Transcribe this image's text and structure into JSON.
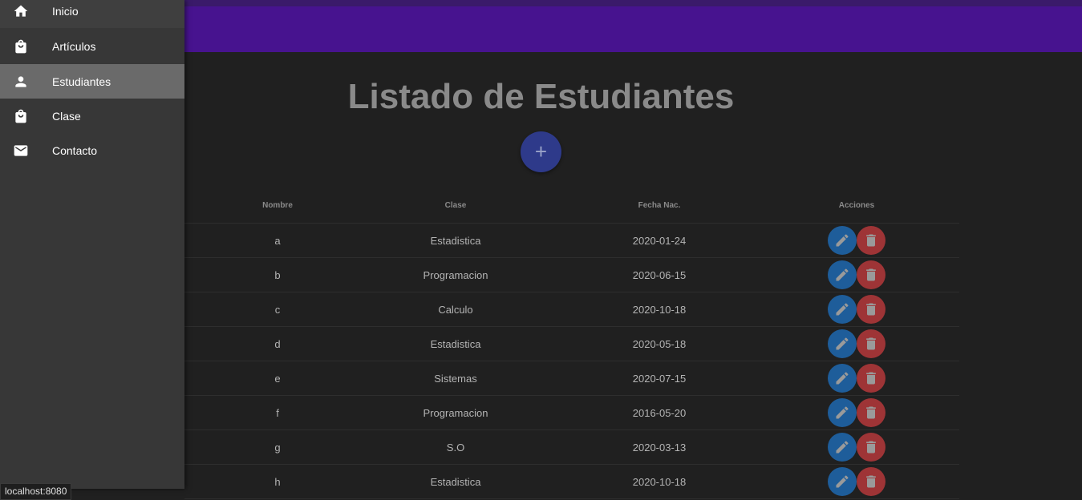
{
  "drawer": {
    "items": [
      {
        "label": "Inicio",
        "icon": "home-icon"
      },
      {
        "label": "Artículos",
        "icon": "shopping-bag-icon"
      },
      {
        "label": "Estudiantes",
        "icon": "person-icon"
      },
      {
        "label": "Clase",
        "icon": "shopping-bag-icon"
      },
      {
        "label": "Contacto",
        "icon": "mail-icon"
      }
    ],
    "active": "Estudiantes"
  },
  "page": {
    "title": "Listado de Estudiantes",
    "add_button": "+"
  },
  "table": {
    "headers": {
      "name": "Nombre",
      "class": "Clase",
      "date": "Fecha Nac.",
      "actions": "Acciones"
    },
    "rows": [
      {
        "name": "a",
        "class": "Estadistica",
        "date": "2020-01-24"
      },
      {
        "name": "b",
        "class": "Programacion",
        "date": "2020-06-15"
      },
      {
        "name": "c",
        "class": "Calculo",
        "date": "2020-10-18"
      },
      {
        "name": "d",
        "class": "Estadistica",
        "date": "2020-05-18"
      },
      {
        "name": "e",
        "class": "Sistemas",
        "date": "2020-07-15"
      },
      {
        "name": "f",
        "class": "Programacion",
        "date": "2016-05-20"
      },
      {
        "name": "g",
        "class": "S.O",
        "date": "2020-03-13"
      },
      {
        "name": "h",
        "class": "Estadistica",
        "date": "2020-10-18"
      }
    ]
  },
  "status_bar": {
    "url": "localhost:8080"
  },
  "colors": {
    "appbar": "#47138f",
    "edit": "#1e5d9a",
    "delete": "#9e3436",
    "fab": "#2e3a8a"
  }
}
